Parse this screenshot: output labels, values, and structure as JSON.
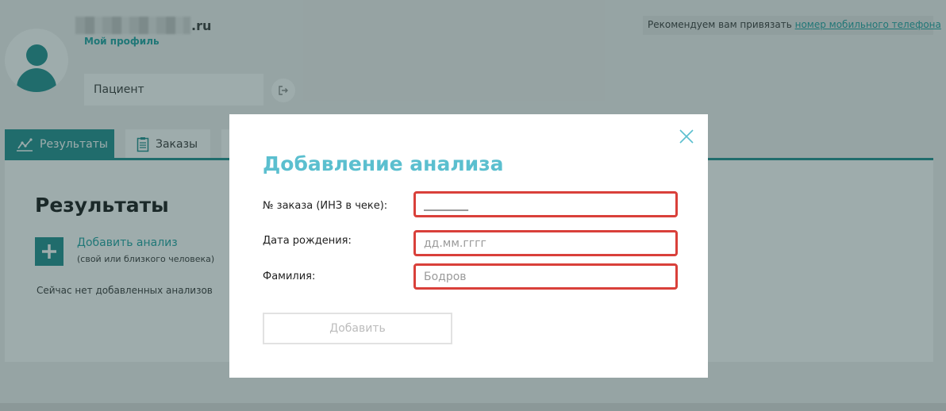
{
  "header": {
    "email_suffix": ".ru",
    "profile_link": "Мой профиль",
    "role": "Пациент",
    "recommend_text": "Рекомендуем вам привязать ",
    "recommend_link": "номер мобильного телефона"
  },
  "tabs": [
    {
      "label": "Результаты",
      "icon": "chart-icon",
      "active": true
    },
    {
      "label": "Заказы",
      "icon": "clipboard-icon",
      "active": false
    }
  ],
  "results": {
    "title": "Результаты",
    "add_label": "Добавить анализ",
    "add_sub": "(свой или близкого человека)",
    "empty_msg": "Сейчас нет добавленных анализов"
  },
  "modal": {
    "title": "Добавление анализа",
    "fields": [
      {
        "label": "№ заказа (ИНЗ в чеке):",
        "value": "________",
        "placeholder": ""
      },
      {
        "label": "Дата рождения:",
        "value": "",
        "placeholder": "дд.мм.гггг"
      },
      {
        "label": "Фамилия:",
        "value": "",
        "placeholder": "Бодров"
      }
    ],
    "submit_label": "Добавить"
  },
  "colors": {
    "accent": "#1a8a8a",
    "link": "#1a9e9e",
    "modal_title": "#5bbfcf",
    "error_border": "#d9403a"
  }
}
